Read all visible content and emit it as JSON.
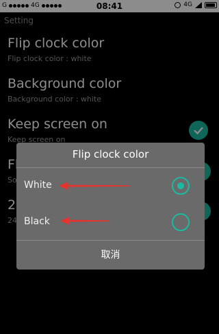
{
  "status_bar": {
    "carrier": "G",
    "network_left": "4G",
    "time": "08:41",
    "network_right": "4G"
  },
  "header": {
    "title": "Setting"
  },
  "settings": [
    {
      "title": "Flip clock color",
      "subtitle": "Flip clock color : white"
    },
    {
      "title": "Background color",
      "subtitle": "Background color : white"
    },
    {
      "title": "Keep screen on",
      "subtitle": "Keep screen on"
    },
    {
      "title": "Fl",
      "subtitle": "So"
    },
    {
      "title": "24",
      "subtitle": "24"
    }
  ],
  "dialog": {
    "title": "Flip clock color",
    "options": [
      {
        "label": "White",
        "selected": true
      },
      {
        "label": "Black",
        "selected": false
      }
    ],
    "cancel_label": "取消"
  },
  "colors": {
    "accent": "#1bb9a0",
    "arrow": "#e8322d",
    "dialog_bg": "#6a6a6a"
  }
}
